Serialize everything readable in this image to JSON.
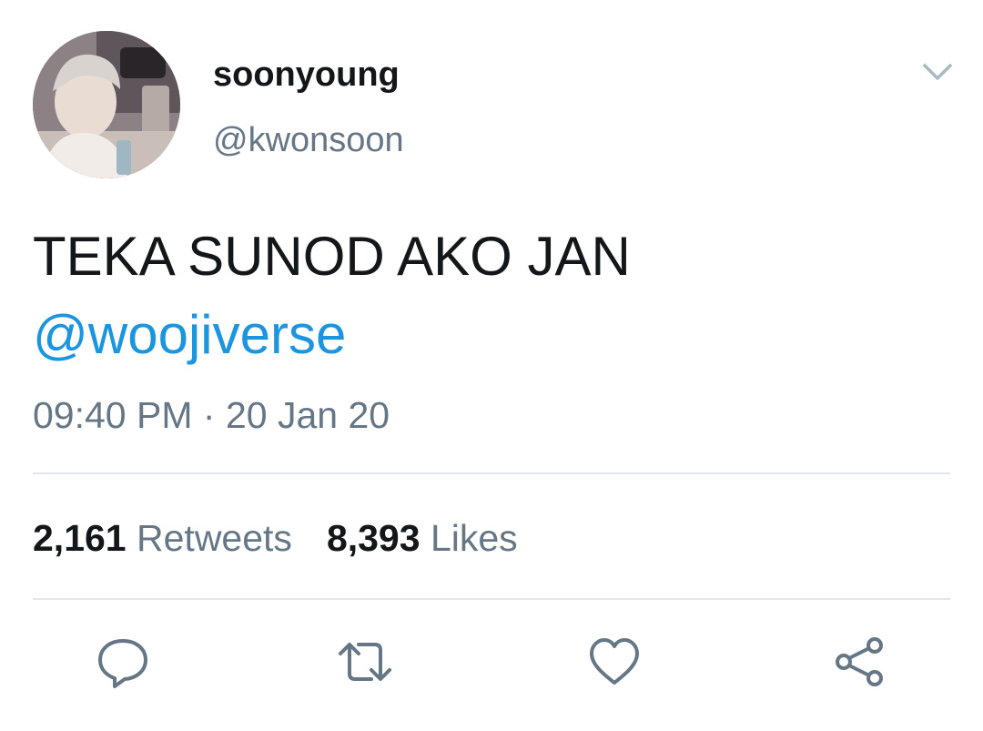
{
  "user": {
    "display_name": "soonyoung",
    "handle": "@kwonsoon"
  },
  "tweet": {
    "text": "TEKA SUNOD AKO JAN",
    "mention": "@woojiverse",
    "time": "09:40 PM",
    "separator": "·",
    "date": "20 Jan 20"
  },
  "stats": {
    "retweets_count": "2,161",
    "retweets_label": "Retweets",
    "likes_count": "8,393",
    "likes_label": "Likes"
  },
  "icons": {
    "menu": "chevron-down-icon",
    "reply": "reply-icon",
    "retweet": "retweet-icon",
    "like": "heart-icon",
    "share": "share-icon"
  },
  "colors": {
    "text": "#14171a",
    "secondary": "#657786",
    "link": "#1b95e0",
    "divider": "#e1e8ed",
    "icon": "#657786"
  }
}
